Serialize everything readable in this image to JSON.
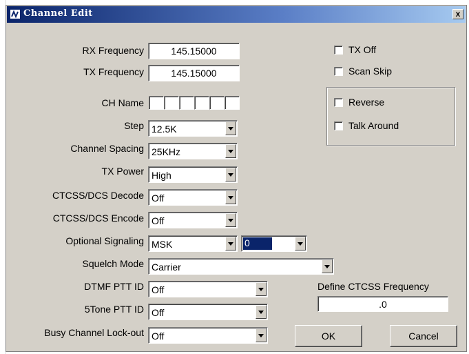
{
  "window": {
    "title": "Channel Edit",
    "close_label": "x"
  },
  "labels": {
    "rx_frequency": "RX Frequency",
    "tx_frequency": "TX Frequency",
    "ch_name": "CH Name",
    "step": "Step",
    "channel_spacing": "Channel Spacing",
    "tx_power": "TX Power",
    "ctcss_decode": "CTCSS/DCS Decode",
    "ctcss_encode": "CTCSS/DCS Encode",
    "optional_signaling": "Optional Signaling",
    "squelch_mode": "Squelch Mode",
    "dtmf_ptt_id": "DTMF PTT ID",
    "fivetone_ptt_id": "5Tone PTT ID",
    "busy_channel_lockout": "Busy Channel Lock-out",
    "define_ctcss": "Define CTCSS Frequency"
  },
  "values": {
    "rx_frequency": "145.15000",
    "tx_frequency": "145.15000",
    "step": "12.5K",
    "channel_spacing": "25KHz",
    "tx_power": "High",
    "ctcss_decode": "Off",
    "ctcss_encode": "Off",
    "optional_signaling": "MSK",
    "optional_signaling_code": "0",
    "squelch_mode": "Carrier",
    "dtmf_ptt_id": "Off",
    "fivetone_ptt_id": "Off",
    "busy_channel_lockout": "Off",
    "define_ctcss": ".0"
  },
  "checkboxes": {
    "tx_off": {
      "label": "TX Off",
      "checked": false
    },
    "scan_skip": {
      "label": "Scan Skip",
      "checked": false
    },
    "reverse": {
      "label": "Reverse",
      "checked": false
    },
    "talk_around": {
      "label": "Talk Around",
      "checked": false
    }
  },
  "buttons": {
    "ok": "OK",
    "cancel": "Cancel"
  },
  "icons": {
    "title": "channel-icon",
    "dropdown": "dropdown-arrow-icon"
  },
  "colors": {
    "titlebar": "#0a246a",
    "face": "#d4d0c8",
    "selection": "#0a246a"
  }
}
